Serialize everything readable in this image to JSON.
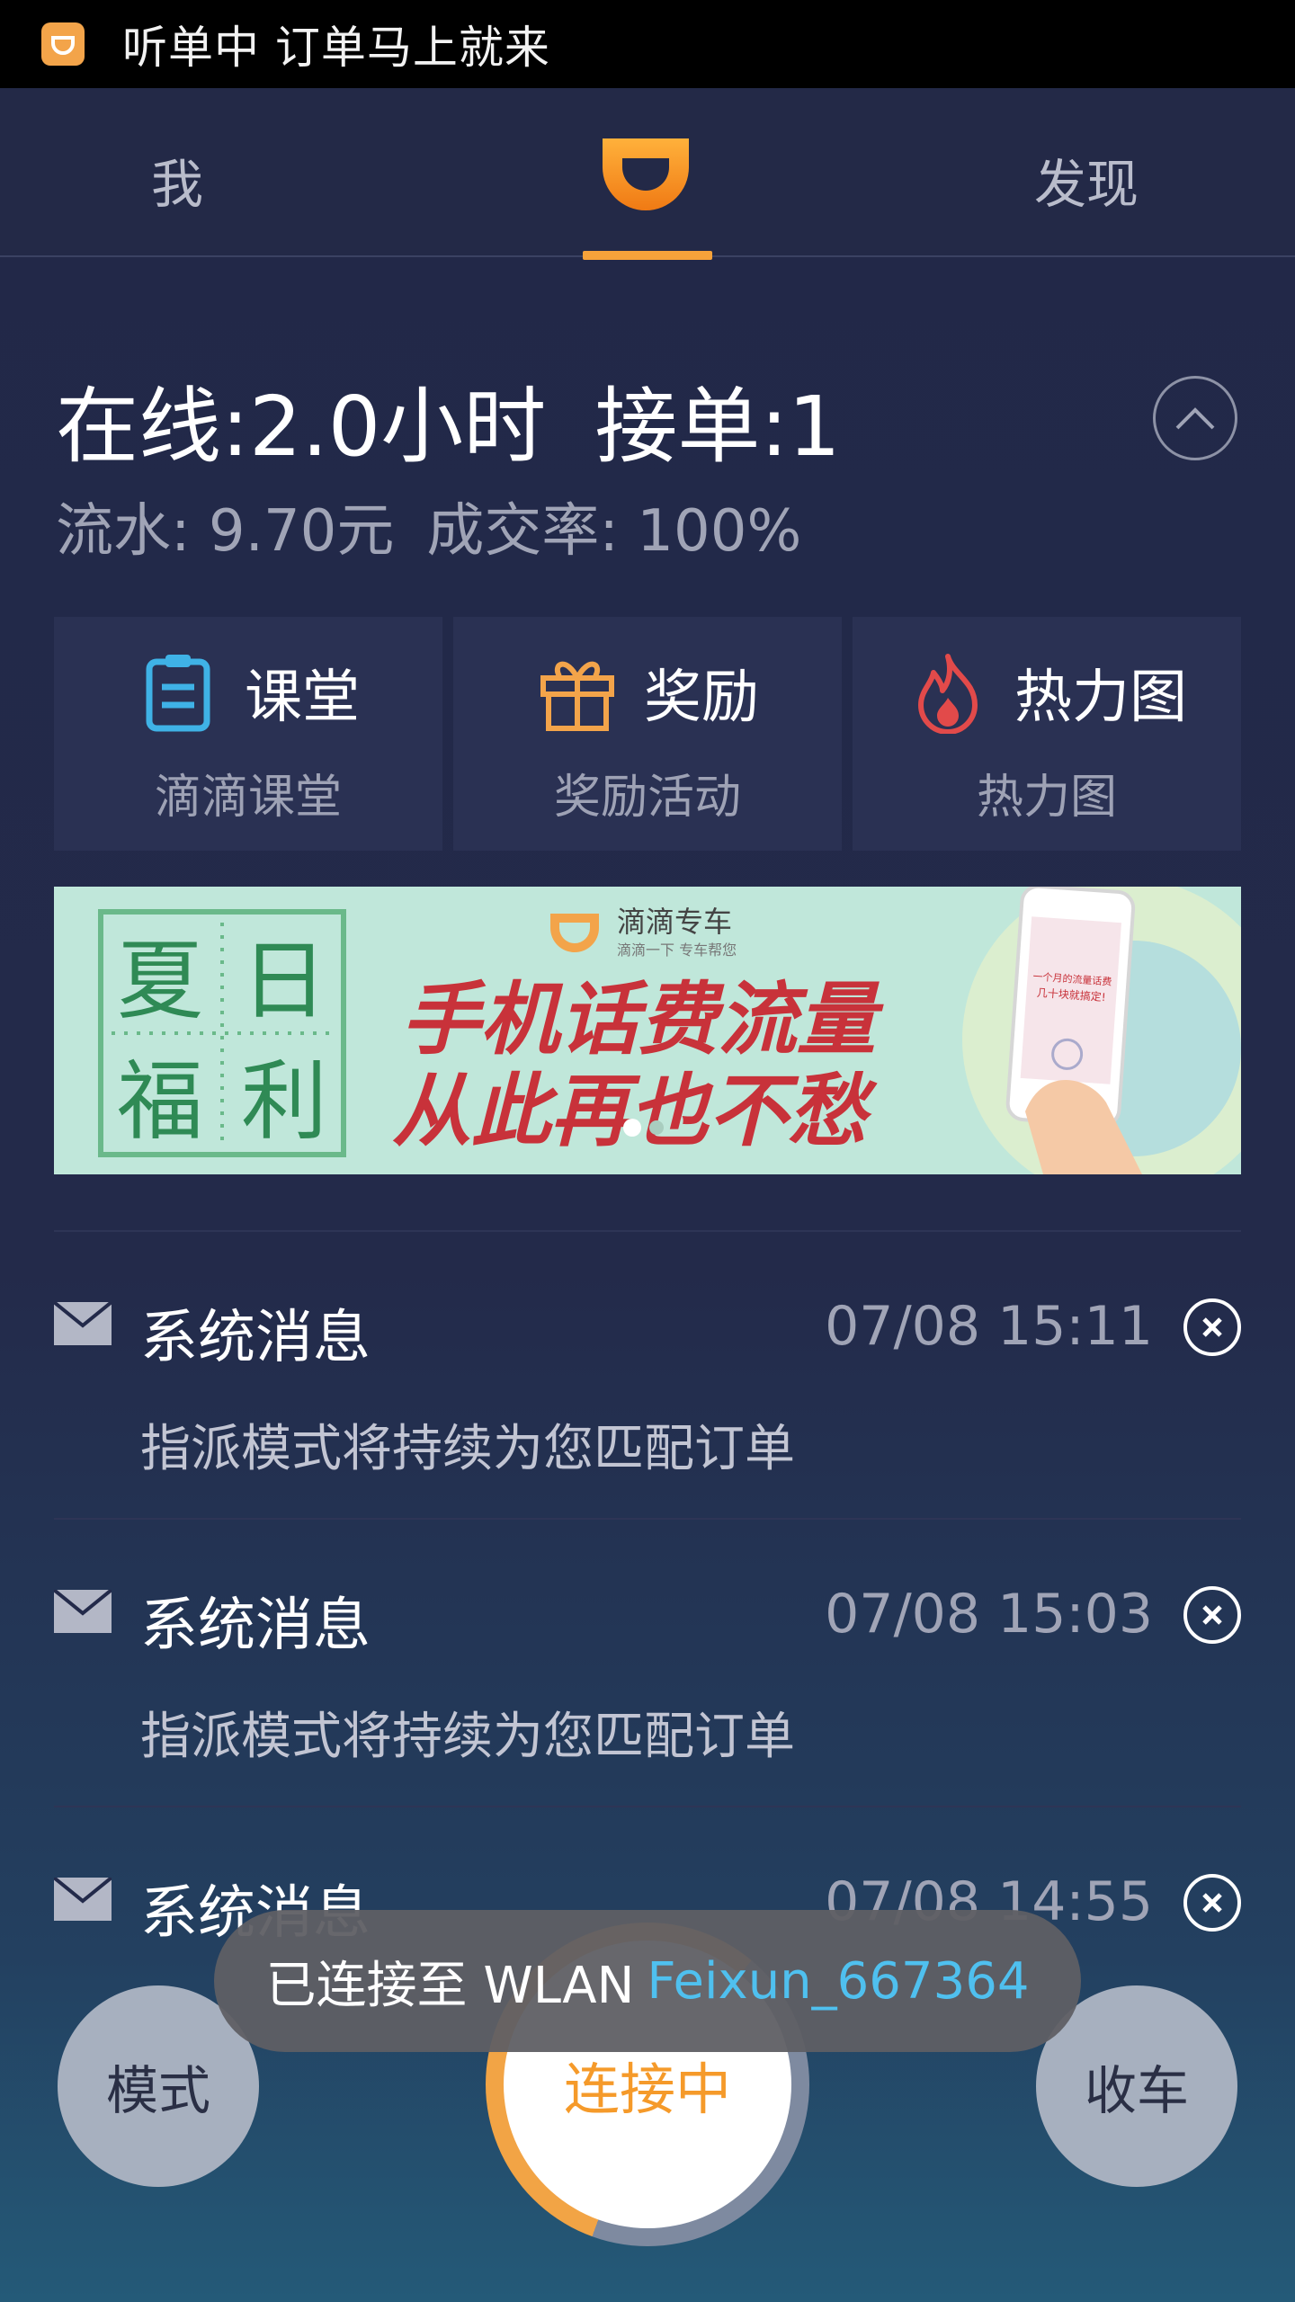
{
  "status_bar": {
    "app_icon": "didi-app-icon",
    "text": "听单中 订单马上就来"
  },
  "nav": {
    "left_tab": "我",
    "center_icon": "didi-logo-icon",
    "right_tab": "发现",
    "accent": "#f6a23a"
  },
  "stats": {
    "online": "在线:2.0小时",
    "orders": "接单:1",
    "revenue": "流水: 9.70元",
    "rate": "成交率: 100%"
  },
  "cards": [
    {
      "icon": "clipboard-icon",
      "title": "课堂",
      "subtitle": "滴滴课堂"
    },
    {
      "icon": "gift-icon",
      "title": "奖励",
      "subtitle": "奖励活动"
    },
    {
      "icon": "flame-icon",
      "title": "热力图",
      "subtitle": "热力图"
    }
  ],
  "banner": {
    "corner_chars": [
      "夏",
      "日",
      "福",
      "利"
    ],
    "brand": "滴滴专车",
    "brand_sub": "滴滴一下 专车帮您",
    "headline1": "手机话费流量",
    "headline2": "从此再也不愁",
    "phone_text1": "一个月的流量话费",
    "phone_text2": "几十块就搞定!"
  },
  "messages": [
    {
      "title": "系统消息",
      "time": "07/08 15:11",
      "body": "指派模式将持续为您匹配订单"
    },
    {
      "title": "系统消息",
      "time": "07/08 15:03",
      "body": "指派模式将持续为您匹配订单"
    },
    {
      "title": "系统消息",
      "time": "07/08 14:55",
      "body": ""
    }
  ],
  "buttons": {
    "mode": "模式",
    "center": "连接中",
    "stop": "收车"
  },
  "toast": {
    "prefix": "已连接至 WLAN",
    "ssid": "Feixun_667364"
  }
}
